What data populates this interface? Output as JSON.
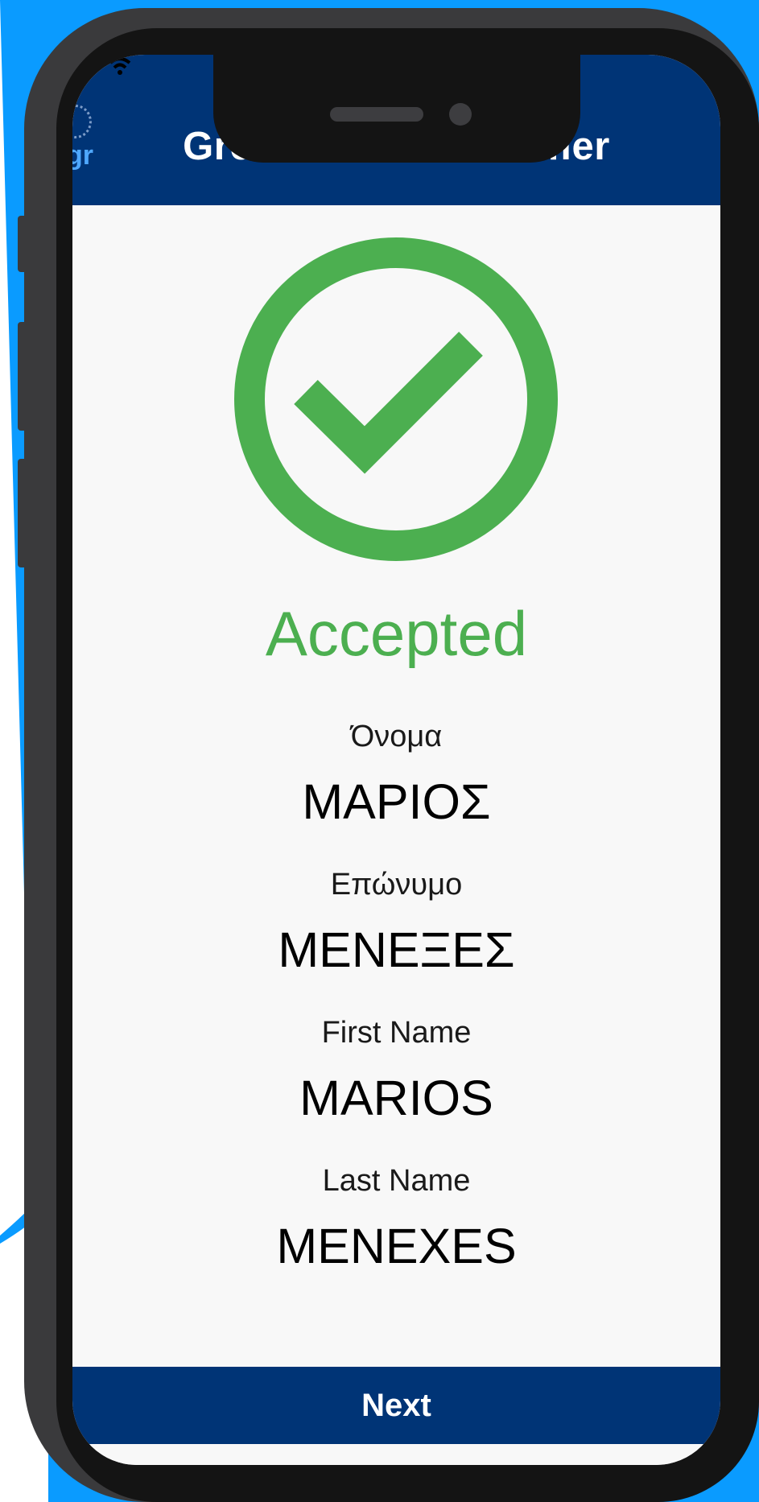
{
  "colors": {
    "backdrop": "#0a9bff",
    "header": "#003476",
    "accent_green": "#4caf50",
    "screen_bg": "#f8f8f8"
  },
  "header": {
    "title": "Greek EU DCC Verifier",
    "logo_text": "gr"
  },
  "result": {
    "icon": "check-circle-icon",
    "status": "Accepted"
  },
  "fields": [
    {
      "label": "Όνομα",
      "value": "ΜΑΡΙΟΣ"
    },
    {
      "label": "Επώνυμο",
      "value": "ΜΕΝΕΞΕΣ"
    },
    {
      "label": "First Name",
      "value": "MARIOS"
    },
    {
      "label": "Last Name",
      "value": "MENEXES"
    }
  ],
  "footer": {
    "next_label": "Next"
  }
}
